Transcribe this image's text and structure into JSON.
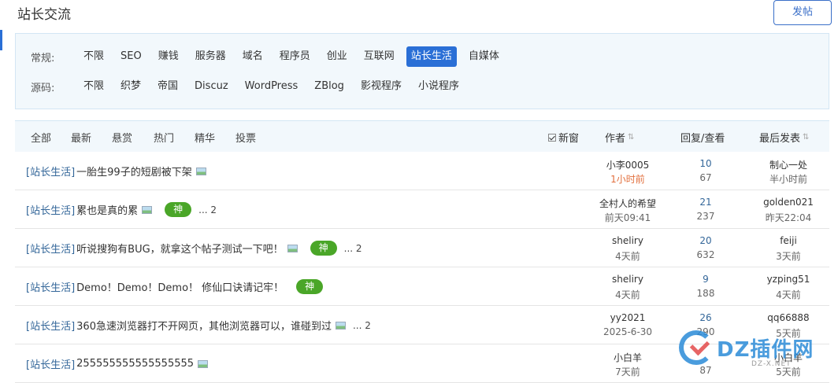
{
  "page": {
    "title": "站长交流",
    "post_button": "发帖"
  },
  "filters": {
    "row1": {
      "label": "常规:",
      "items": [
        "不限",
        "SEO",
        "赚钱",
        "服务器",
        "域名",
        "程序员",
        "创业",
        "互联网",
        "站长生活",
        "自媒体"
      ],
      "active": "站长生活"
    },
    "row2": {
      "label": "源码:",
      "items": [
        "不限",
        "织梦",
        "帝国",
        "Discuz",
        "WordPress",
        "ZBlog",
        "影视程序",
        "小说程序"
      ]
    }
  },
  "list_header": {
    "tabs": [
      "全部",
      "最新",
      "悬赏",
      "热门",
      "精华",
      "投票"
    ],
    "new_window": "新窗",
    "author": "作者",
    "replies_views": "回复/查看",
    "last_post": "最后发表",
    "sort_icon": "sort-arrows-icon"
  },
  "threads": [
    {
      "category": "[站长生活]",
      "title": "一胎生99子的短剧被下架",
      "has_image": true,
      "badge": "",
      "pages": "",
      "author": "小李0005",
      "author_time": "1小时前",
      "replies": "10",
      "views": "67",
      "last_user": "制心一处",
      "last_time": "半小时前"
    },
    {
      "category": "[站长生活]",
      "title": "累也是真的累",
      "has_image": true,
      "badge": "神",
      "pages": "... 2",
      "author": "全村人的希望",
      "author_time": "前天09:41",
      "replies": "21",
      "views": "237",
      "last_user": "golden021",
      "last_time": "昨天22:04"
    },
    {
      "category": "[站长生活]",
      "title": "听说搜狗有BUG，就拿这个帖子测试一下吧！",
      "has_image": true,
      "badge": "神",
      "pages": "... 2",
      "author": "sheliry",
      "author_time": "4天前",
      "replies": "20",
      "views": "632",
      "last_user": "feiji",
      "last_time": "3天前"
    },
    {
      "category": "[站长生活]",
      "title": "Demo！Demo！Demo！ 修仙口诀请记牢！",
      "has_image": false,
      "badge": "神",
      "pages": "",
      "author": "sheliry",
      "author_time": "4天前",
      "replies": "9",
      "views": "188",
      "last_user": "yzping51",
      "last_time": "4天前"
    },
    {
      "category": "[站长生活]",
      "title": "360急速浏览器打不开网页，其他浏览器可以，谁碰到过",
      "has_image": true,
      "badge": "",
      "pages": "... 2",
      "author": "yy2021",
      "author_time": "2025-6-30",
      "replies": "26",
      "views": "290",
      "last_user": "qq66888",
      "last_time": "5天前"
    },
    {
      "category": "[站长生活]",
      "title": "255555555555555555",
      "has_image": true,
      "badge": "",
      "pages": "",
      "author": "小白羊",
      "author_time": "7天前",
      "replies": "",
      "views": "87",
      "last_user": "小白羊",
      "last_time": "5天前"
    }
  ],
  "watermark": {
    "text": "DZ插件网",
    "sub": "DZ-X.NET"
  }
}
